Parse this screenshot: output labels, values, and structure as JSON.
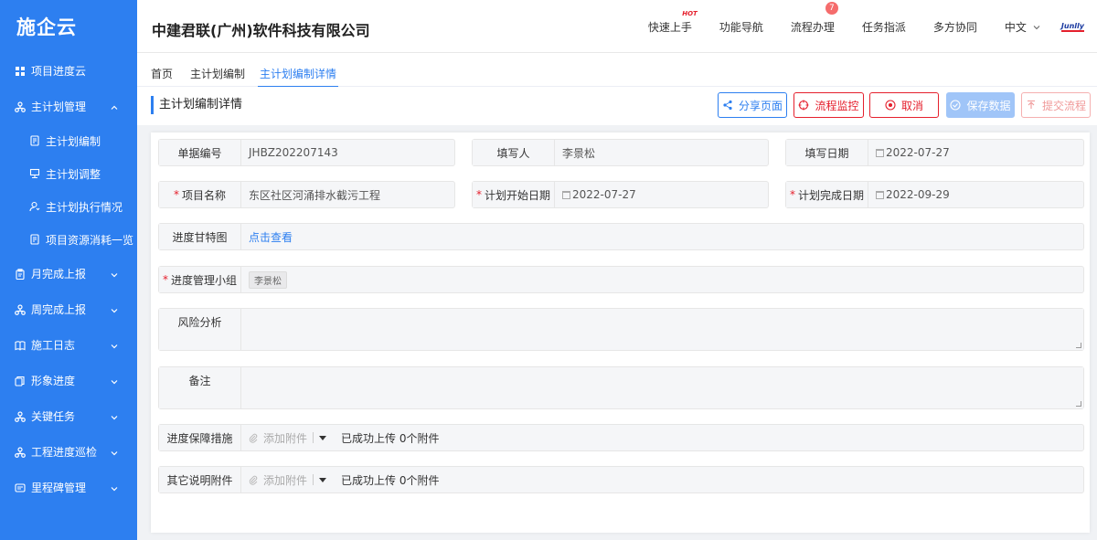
{
  "app": {
    "logo": "施企云",
    "company": "中建君联(广州)软件科技有限公司"
  },
  "sidebar": {
    "items": [
      {
        "label": "项目进度云",
        "icon": "grid-icon"
      },
      {
        "label": "主计划管理",
        "icon": "org-icon",
        "expanded": true,
        "children": [
          {
            "label": "主计划编制",
            "icon": "doc-icon"
          },
          {
            "label": "主计划调整",
            "icon": "adjust-icon"
          },
          {
            "label": "主计划执行情况",
            "icon": "person-icon"
          },
          {
            "label": "项目资源消耗一览",
            "icon": "doc-icon"
          }
        ]
      },
      {
        "label": "月完成上报",
        "icon": "clipboard-icon"
      },
      {
        "label": "周完成上报",
        "icon": "org-icon"
      },
      {
        "label": "施工日志",
        "icon": "book-icon"
      },
      {
        "label": "形象进度",
        "icon": "stack-icon"
      },
      {
        "label": "关键任务",
        "icon": "org-icon"
      },
      {
        "label": "工程进度巡检",
        "icon": "org-icon"
      },
      {
        "label": "里程碑管理",
        "icon": "milestone-icon"
      }
    ]
  },
  "header": {
    "menu": [
      "快速上手",
      "功能导航",
      "流程办理",
      "任务指派",
      "多方协同"
    ],
    "hot_label": "HOT",
    "process_badge": "7",
    "language": "中文",
    "brand": "Junlly"
  },
  "tabs": [
    {
      "label": "首页",
      "active": false
    },
    {
      "label": "主计划编制",
      "active": false
    },
    {
      "label": "主计划编制详情",
      "active": true
    }
  ],
  "page": {
    "title": "主计划编制详情",
    "buttons": {
      "share": "分享页面",
      "monitor": "流程监控",
      "cancel": "取消",
      "save": "保存数据",
      "submit": "提交流程"
    }
  },
  "form": {
    "doc_no": {
      "label": "单据编号",
      "value": "JHBZ202207143"
    },
    "author": {
      "label": "填写人",
      "value": "李景松"
    },
    "fill_date": {
      "label": "填写日期",
      "value": "2022-07-27"
    },
    "project": {
      "label": "项目名称",
      "value": "东区社区河涌排水截污工程"
    },
    "start_date": {
      "label": "计划开始日期",
      "value": "2022-07-27"
    },
    "end_date": {
      "label": "计划完成日期",
      "value": "2022-09-29"
    },
    "gantt": {
      "label": "进度甘特图",
      "value": "点击查看"
    },
    "team": {
      "label": "进度管理小组",
      "value": "李景松"
    },
    "risk": {
      "label": "风险分析",
      "value": ""
    },
    "remark": {
      "label": "备注",
      "value": ""
    },
    "measures": {
      "label": "进度保障措施",
      "add": "添加附件",
      "status": "已成功上传 0个附件"
    },
    "other": {
      "label": "其它说明附件",
      "add": "添加附件",
      "status": "已成功上传 0个附件"
    }
  },
  "colors": {
    "primary": "#2d7ff0",
    "danger": "#e5202d"
  }
}
